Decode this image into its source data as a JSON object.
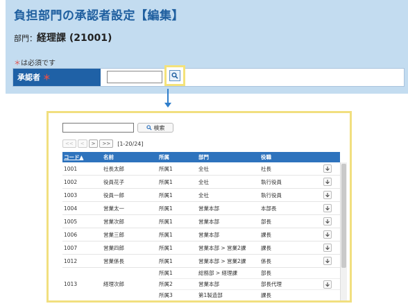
{
  "form": {
    "title": "負担部門の承認者設定【編集】",
    "dept_label": "部門：",
    "dept_value": "経理課 (21001)",
    "required_star": "＊",
    "required_note": "は必須です",
    "approver_label": "承認者",
    "approver_value": ""
  },
  "popup": {
    "search_value": "",
    "search_button": "検索",
    "pager": {
      "first": "<<",
      "prev": "<",
      "next": ">",
      "last": ">>",
      "range": "[1-20/24]"
    },
    "columns": {
      "code": "コード▲",
      "name": "名前",
      "affiliation": "所属",
      "dept": "部門",
      "position": "役職"
    },
    "rows": [
      {
        "code": "1001",
        "name": "社長太郎",
        "affiliation": "所属1",
        "dept": "全社",
        "position": "社長"
      },
      {
        "code": "1002",
        "name": "役員花子",
        "affiliation": "所属1",
        "dept": "全社",
        "position": "執行役員"
      },
      {
        "code": "1003",
        "name": "役員一郎",
        "affiliation": "所属1",
        "dept": "全社",
        "position": "執行役員"
      },
      {
        "code": "1004",
        "name": "営業太一",
        "affiliation": "所属1",
        "dept": "営業本部",
        "position": "本部長"
      },
      {
        "code": "1005",
        "name": "営業次郎",
        "affiliation": "所属1",
        "dept": "営業本部",
        "position": "部長"
      },
      {
        "code": "1006",
        "name": "営業三郎",
        "affiliation": "所属1",
        "dept": "営業本部",
        "position": "課長"
      },
      {
        "code": "1007",
        "name": "営業四郎",
        "affiliation": "所属1",
        "dept": "営業本部 > 営業2課",
        "position": "課長"
      },
      {
        "code": "1012",
        "name": "営業係長",
        "affiliation": "所属1",
        "dept": "営業本部 > 営業2課",
        "position": "係長"
      }
    ],
    "multi_row": {
      "code": "1013",
      "name": "経理次郎",
      "subs": [
        {
          "affiliation": "所属1",
          "dept": "総務部 > 経理課",
          "position": "部長"
        },
        {
          "affiliation": "所属2",
          "dept": "営業本部",
          "position": "部長代理"
        },
        {
          "affiliation": "所属3",
          "dept": "第1製造部",
          "position": "課長"
        }
      ]
    }
  },
  "icons": {
    "search": "search-icon",
    "select": "arrow-down-icon"
  },
  "colors": {
    "panel_bg": "#c3dcf0",
    "title": "#1f5f9f",
    "label_bg": "#1f61a6",
    "highlight": "#f4e27a",
    "grid_header": "#2e73bd"
  }
}
